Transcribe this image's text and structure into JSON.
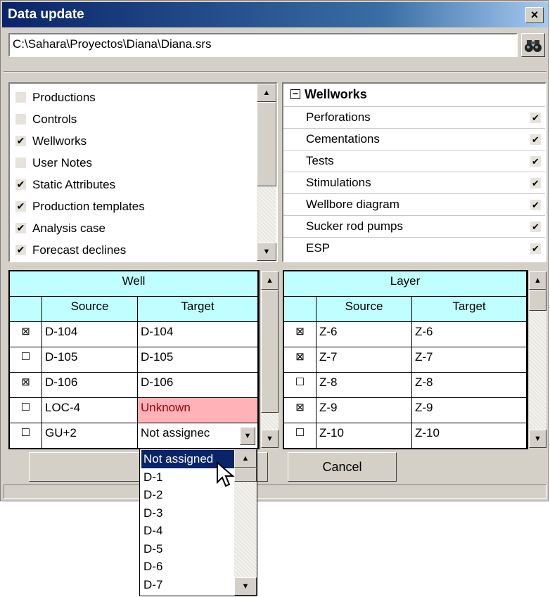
{
  "window": {
    "title": "Data update",
    "close_label": "×"
  },
  "path": {
    "value": "C:\\Sahara\\Proyectos\\Diana\\Diana.srs",
    "browse_icon": "binoculars-icon"
  },
  "categories": [
    {
      "label": "Productions",
      "checked": false,
      "mark": ""
    },
    {
      "label": "Controls",
      "checked": false,
      "mark": ""
    },
    {
      "label": "Wellworks",
      "checked": true,
      "mark": "✔"
    },
    {
      "label": "User Notes",
      "checked": false,
      "mark": ""
    },
    {
      "label": "Static Attributes",
      "checked": true,
      "mark": "✔"
    },
    {
      "label": "Production templates",
      "checked": true,
      "mark": "✔"
    },
    {
      "label": "Analysis case",
      "checked": true,
      "mark": "✔"
    },
    {
      "label": "Forecast declines",
      "checked": true,
      "mark": "✔"
    }
  ],
  "wellworks": {
    "header": "Wellworks",
    "collapse_mark": "−",
    "items": [
      {
        "label": "Perforations",
        "mark": "✔"
      },
      {
        "label": "Cementations",
        "mark": "✔"
      },
      {
        "label": "Tests",
        "mark": "✔"
      },
      {
        "label": "Stimulations",
        "mark": "✔"
      },
      {
        "label": "Wellbore diagram",
        "mark": "✔"
      },
      {
        "label": "Sucker rod pumps",
        "mark": "✔"
      },
      {
        "label": "ESP",
        "mark": "✔"
      }
    ]
  },
  "well_grid": {
    "title": "Well",
    "col_source": "Source",
    "col_target": "Target",
    "rows": [
      {
        "mark": "⊠",
        "source": "D-104",
        "target": "D-104"
      },
      {
        "mark": "☐",
        "source": "D-105",
        "target": "D-105"
      },
      {
        "mark": "⊠",
        "source": "D-106",
        "target": "D-106"
      },
      {
        "mark": "☐",
        "source": "LOC-4",
        "target": "Unknown"
      },
      {
        "mark": "☐",
        "source": "GU+2",
        "target": "Not assignec"
      }
    ]
  },
  "layer_grid": {
    "title": "Layer",
    "col_source": "Source",
    "col_target": "Target",
    "rows": [
      {
        "mark": "⊠",
        "source": "Z-6",
        "target": "Z-6"
      },
      {
        "mark": "⊠",
        "source": "Z-7",
        "target": "Z-7"
      },
      {
        "mark": "☐",
        "source": "Z-8",
        "target": "Z-8"
      },
      {
        "mark": "⊠",
        "source": "Z-9",
        "target": "Z-9"
      },
      {
        "mark": "☐",
        "source": "Z-10",
        "target": "Z-10"
      }
    ]
  },
  "buttons": {
    "cancel": "Cancel"
  },
  "dropdown": {
    "items": [
      "Not assigned",
      "D-1",
      "D-2",
      "D-3",
      "D-4",
      "D-5",
      "D-6",
      "D-7"
    ],
    "selected": "Not assigned"
  },
  "colors": {
    "grid_header": "#c0ffff",
    "unknown_cell": "#ffb3b8",
    "selection": "#0a246a"
  }
}
